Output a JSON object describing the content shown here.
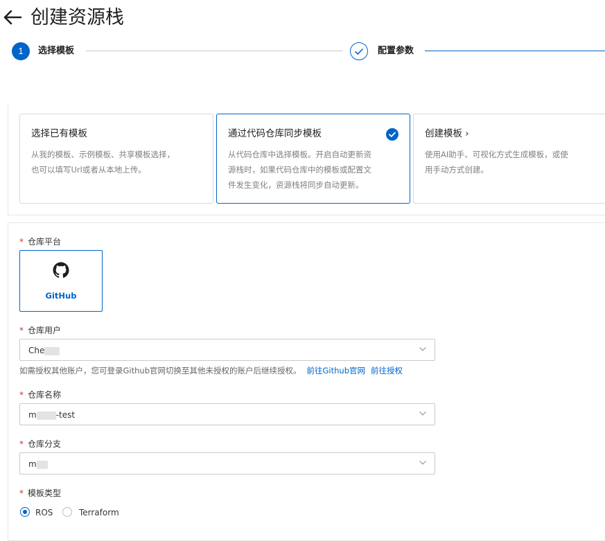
{
  "header": {
    "title": "创建资源栈"
  },
  "steps": [
    {
      "index": "1",
      "label": "选择模板"
    },
    {
      "label": "配置参数"
    }
  ],
  "cards": [
    {
      "title": "选择已有模板",
      "desc_lines": [
        "从我的模板、示例模板、共享模板选择，",
        "也可以填写Url或者从本地上传。"
      ]
    },
    {
      "title": "通过代码仓库同步模板",
      "desc_lines": [
        "从代码仓库中选择模板。开启自动更新资",
        "源栈时，如果代码仓库中的模板或配置文",
        "件发生变化，资源栈将同步自动更新。"
      ],
      "selected": true
    },
    {
      "title": "创建模板 ›",
      "desc_lines": [
        "使用AI助手、可视化方式生成模板，或使",
        "用手动方式创建。"
      ]
    }
  ],
  "form": {
    "required_mark": "*",
    "platform_label": "仓库平台",
    "platform_option": "GitHub",
    "user_label": "仓库用户",
    "user_value": "Che",
    "hint_text": "如需授权其他账户，您可登录Github官网切换至其他未授权的账户后继续授权。",
    "hint_link1": "前往Github官网",
    "hint_link2": "前往授权",
    "repo_label": "仓库名称",
    "repo_value_prefix": "m",
    "repo_value_suffix": "-test",
    "branch_label": "仓库分支",
    "branch_value": "m",
    "type_label": "模板类型",
    "type_options": [
      {
        "label": "ROS",
        "selected": true
      },
      {
        "label": "Terraform",
        "selected": false
      }
    ]
  },
  "colors": {
    "primary": "#0064c8",
    "required": "#d93026"
  },
  "icons": {
    "back": "arrow-left-icon",
    "check": "check-icon",
    "github": "github-icon",
    "chevron": "chevron-down-icon"
  }
}
